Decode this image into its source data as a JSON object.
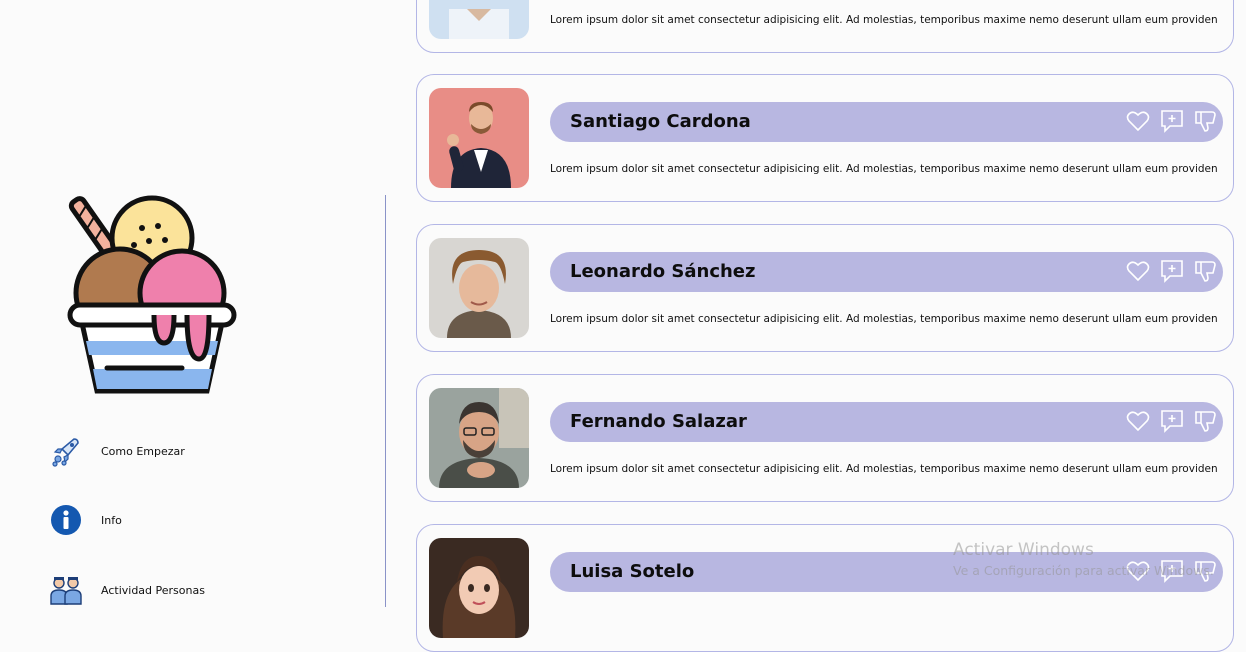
{
  "nav": {
    "items": [
      {
        "label": "Como Empezar",
        "icon": "rocket-icon"
      },
      {
        "label": "Info",
        "icon": "info-icon"
      },
      {
        "label": "Actividad Personas",
        "icon": "people-icon"
      }
    ]
  },
  "posts": [
    {
      "name": "",
      "text": "Lorem ipsum dolor sit amet consectetur adipisicing elit. Ad molestias, temporibus maxime nemo deserunt ullam eum providen"
    },
    {
      "name": "Santiago Cardona",
      "text": "Lorem ipsum dolor sit amet consectetur adipisicing elit. Ad molestias, temporibus maxime nemo deserunt ullam eum providen"
    },
    {
      "name": "Leonardo Sánchez",
      "text": "Lorem ipsum dolor sit amet consectetur adipisicing elit. Ad molestias, temporibus maxime nemo deserunt ullam eum providen"
    },
    {
      "name": "Fernando Salazar",
      "text": "Lorem ipsum dolor sit amet consectetur adipisicing elit. Ad molestias, temporibus maxime nemo deserunt ullam eum providen"
    },
    {
      "name": "Luisa Sotelo",
      "text": ""
    }
  ],
  "actions": [
    "heart-icon",
    "comment-plus-icon",
    "thumbs-down-icon"
  ],
  "colors": {
    "accent": "#b8b7e1",
    "card_border": "#b3b6e6",
    "background": "#fbfbfb"
  },
  "watermark": {
    "title": "Activar Windows",
    "subtitle": "Ve a Configuración para activar Windows."
  }
}
